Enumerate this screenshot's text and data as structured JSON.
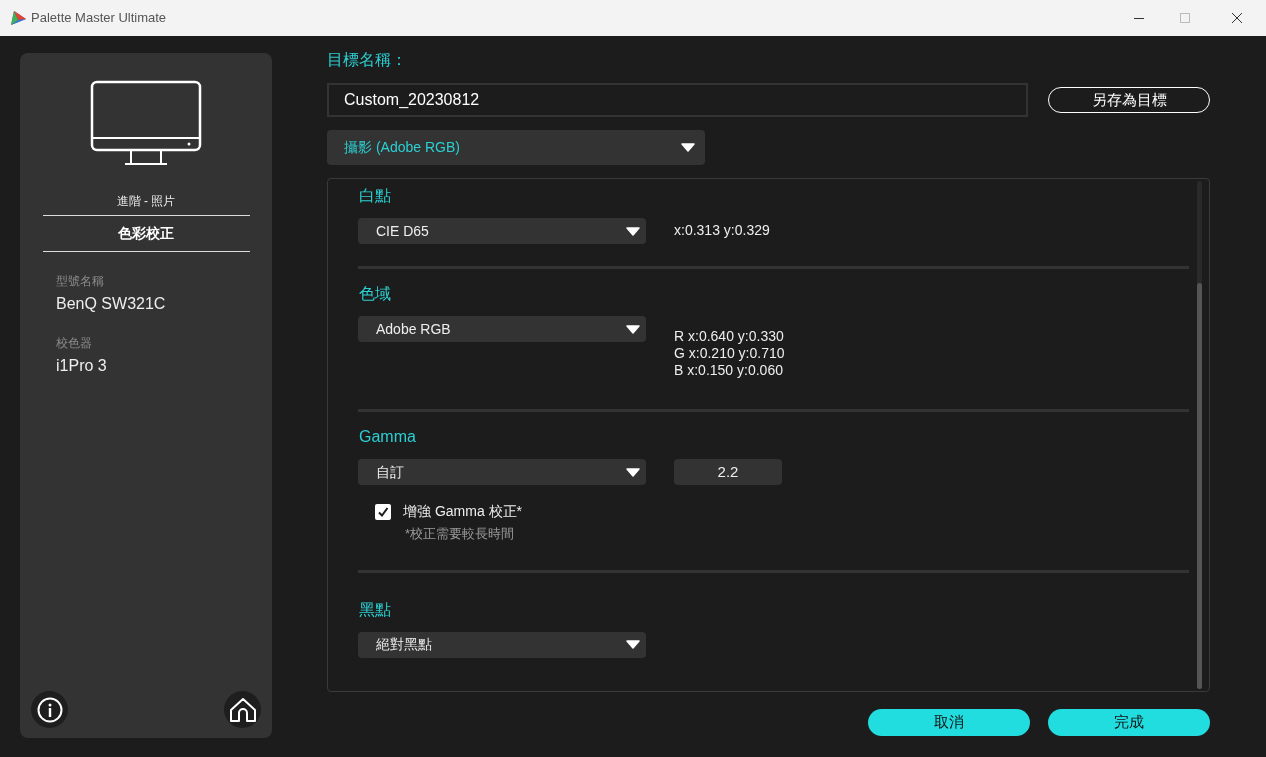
{
  "window": {
    "title": "Palette Master Ultimate"
  },
  "sidebar": {
    "mode": "進階 - 照片",
    "title": "色彩校正",
    "info": [
      {
        "label": "型號名稱",
        "value": "BenQ SW321C"
      },
      {
        "label": "校色器",
        "value": "i1Pro 3"
      }
    ]
  },
  "target": {
    "label": "目標名稱：",
    "value": "Custom_20230812",
    "save_button": "另存為目標"
  },
  "preset": "攝影 (Adobe RGB)",
  "sections": [
    {
      "kind": "select",
      "title": "白點",
      "value": "CIE D65",
      "readings": [
        "x:0.313 y:0.329"
      ]
    },
    {
      "kind": "select",
      "title": "色域",
      "value": "Adobe RGB",
      "readings": [
        "R x:0.640 y:0.330",
        "G x:0.210 y:0.710",
        "B x:0.150 y:0.060"
      ]
    },
    {
      "kind": "gamma",
      "title": "Gamma",
      "value": "自訂",
      "input": "2.2",
      "option": {
        "label": "增強 Gamma 校正*",
        "note": "*校正需要較長時間",
        "checked": true
      }
    },
    {
      "kind": "select",
      "title": "黑點",
      "value": "絕對黑點"
    }
  ],
  "buttons": [
    "取消",
    "完成"
  ]
}
